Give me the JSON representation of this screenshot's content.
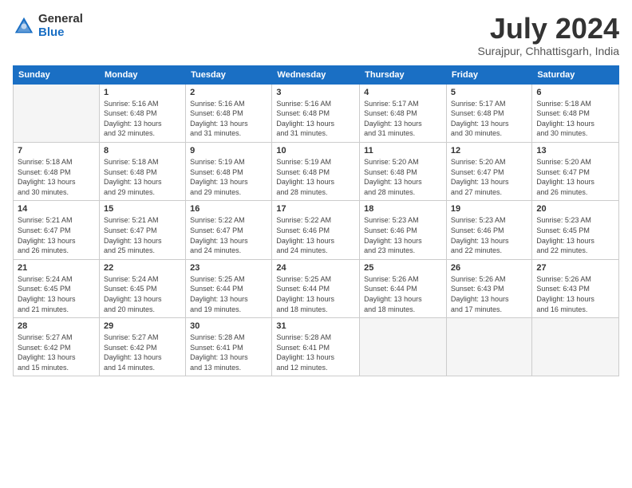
{
  "logo": {
    "general": "General",
    "blue": "Blue"
  },
  "title": "July 2024",
  "location": "Surajpur, Chhattisgarh, India",
  "weekdays": [
    "Sunday",
    "Monday",
    "Tuesday",
    "Wednesday",
    "Thursday",
    "Friday",
    "Saturday"
  ],
  "weeks": [
    [
      {
        "day": "",
        "info": ""
      },
      {
        "day": "1",
        "info": "Sunrise: 5:16 AM\nSunset: 6:48 PM\nDaylight: 13 hours\nand 32 minutes."
      },
      {
        "day": "2",
        "info": "Sunrise: 5:16 AM\nSunset: 6:48 PM\nDaylight: 13 hours\nand 31 minutes."
      },
      {
        "day": "3",
        "info": "Sunrise: 5:16 AM\nSunset: 6:48 PM\nDaylight: 13 hours\nand 31 minutes."
      },
      {
        "day": "4",
        "info": "Sunrise: 5:17 AM\nSunset: 6:48 PM\nDaylight: 13 hours\nand 31 minutes."
      },
      {
        "day": "5",
        "info": "Sunrise: 5:17 AM\nSunset: 6:48 PM\nDaylight: 13 hours\nand 30 minutes."
      },
      {
        "day": "6",
        "info": "Sunrise: 5:18 AM\nSunset: 6:48 PM\nDaylight: 13 hours\nand 30 minutes."
      }
    ],
    [
      {
        "day": "7",
        "info": "Sunrise: 5:18 AM\nSunset: 6:48 PM\nDaylight: 13 hours\nand 30 minutes."
      },
      {
        "day": "8",
        "info": "Sunrise: 5:18 AM\nSunset: 6:48 PM\nDaylight: 13 hours\nand 29 minutes."
      },
      {
        "day": "9",
        "info": "Sunrise: 5:19 AM\nSunset: 6:48 PM\nDaylight: 13 hours\nand 29 minutes."
      },
      {
        "day": "10",
        "info": "Sunrise: 5:19 AM\nSunset: 6:48 PM\nDaylight: 13 hours\nand 28 minutes."
      },
      {
        "day": "11",
        "info": "Sunrise: 5:20 AM\nSunset: 6:48 PM\nDaylight: 13 hours\nand 28 minutes."
      },
      {
        "day": "12",
        "info": "Sunrise: 5:20 AM\nSunset: 6:47 PM\nDaylight: 13 hours\nand 27 minutes."
      },
      {
        "day": "13",
        "info": "Sunrise: 5:20 AM\nSunset: 6:47 PM\nDaylight: 13 hours\nand 26 minutes."
      }
    ],
    [
      {
        "day": "14",
        "info": "Sunrise: 5:21 AM\nSunset: 6:47 PM\nDaylight: 13 hours\nand 26 minutes."
      },
      {
        "day": "15",
        "info": "Sunrise: 5:21 AM\nSunset: 6:47 PM\nDaylight: 13 hours\nand 25 minutes."
      },
      {
        "day": "16",
        "info": "Sunrise: 5:22 AM\nSunset: 6:47 PM\nDaylight: 13 hours\nand 24 minutes."
      },
      {
        "day": "17",
        "info": "Sunrise: 5:22 AM\nSunset: 6:46 PM\nDaylight: 13 hours\nand 24 minutes."
      },
      {
        "day": "18",
        "info": "Sunrise: 5:23 AM\nSunset: 6:46 PM\nDaylight: 13 hours\nand 23 minutes."
      },
      {
        "day": "19",
        "info": "Sunrise: 5:23 AM\nSunset: 6:46 PM\nDaylight: 13 hours\nand 22 minutes."
      },
      {
        "day": "20",
        "info": "Sunrise: 5:23 AM\nSunset: 6:45 PM\nDaylight: 13 hours\nand 22 minutes."
      }
    ],
    [
      {
        "day": "21",
        "info": "Sunrise: 5:24 AM\nSunset: 6:45 PM\nDaylight: 13 hours\nand 21 minutes."
      },
      {
        "day": "22",
        "info": "Sunrise: 5:24 AM\nSunset: 6:45 PM\nDaylight: 13 hours\nand 20 minutes."
      },
      {
        "day": "23",
        "info": "Sunrise: 5:25 AM\nSunset: 6:44 PM\nDaylight: 13 hours\nand 19 minutes."
      },
      {
        "day": "24",
        "info": "Sunrise: 5:25 AM\nSunset: 6:44 PM\nDaylight: 13 hours\nand 18 minutes."
      },
      {
        "day": "25",
        "info": "Sunrise: 5:26 AM\nSunset: 6:44 PM\nDaylight: 13 hours\nand 18 minutes."
      },
      {
        "day": "26",
        "info": "Sunrise: 5:26 AM\nSunset: 6:43 PM\nDaylight: 13 hours\nand 17 minutes."
      },
      {
        "day": "27",
        "info": "Sunrise: 5:26 AM\nSunset: 6:43 PM\nDaylight: 13 hours\nand 16 minutes."
      }
    ],
    [
      {
        "day": "28",
        "info": "Sunrise: 5:27 AM\nSunset: 6:42 PM\nDaylight: 13 hours\nand 15 minutes."
      },
      {
        "day": "29",
        "info": "Sunrise: 5:27 AM\nSunset: 6:42 PM\nDaylight: 13 hours\nand 14 minutes."
      },
      {
        "day": "30",
        "info": "Sunrise: 5:28 AM\nSunset: 6:41 PM\nDaylight: 13 hours\nand 13 minutes."
      },
      {
        "day": "31",
        "info": "Sunrise: 5:28 AM\nSunset: 6:41 PM\nDaylight: 13 hours\nand 12 minutes."
      },
      {
        "day": "",
        "info": ""
      },
      {
        "day": "",
        "info": ""
      },
      {
        "day": "",
        "info": ""
      }
    ]
  ]
}
